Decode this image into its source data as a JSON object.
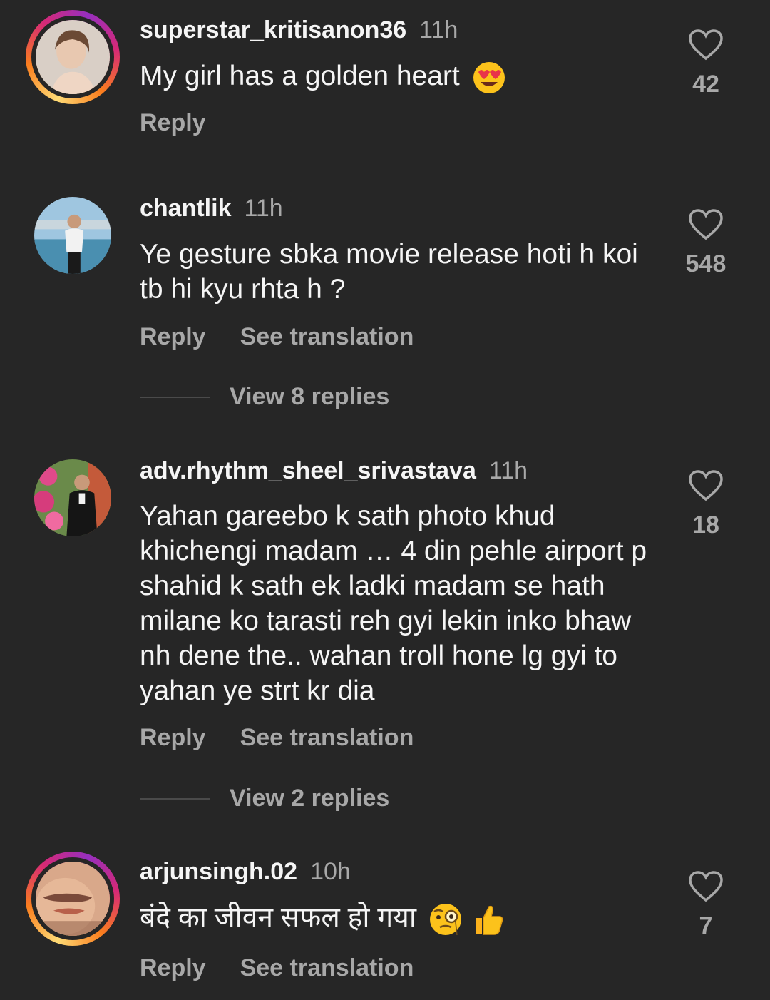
{
  "comments": [
    {
      "username": "superstar_kritisanon36",
      "time": "11h",
      "text": "My girl has a golden heart",
      "emoji": "heart-eyes",
      "likes": "42",
      "reply": "Reply",
      "has_story_ring": true
    },
    {
      "username": "chantlik",
      "time": "11h",
      "text": "Ye gesture sbka movie release hoti h koi tb hi kyu rhta h ?",
      "likes": "548",
      "reply": "Reply",
      "see_translation": "See translation",
      "view_replies": "View 8 replies"
    },
    {
      "username": "adv.rhythm_sheel_srivastava",
      "time": "11h",
      "text": "Yahan gareebo k sath photo khud khichengi madam … 4 din pehle airport p shahid k sath ek ladki madam se hath milane ko tarasti reh gyi lekin inko bhaw nh dene the.. wahan troll hone lg gyi to yahan ye strt kr dia",
      "likes": "18",
      "reply": "Reply",
      "see_translation": "See translation",
      "view_replies": "View 2 replies"
    },
    {
      "username": "arjunsingh.02",
      "time": "10h",
      "text": "बंदे का जीवन सफल हो गया",
      "emoji": "monocle-face, thumbs-up",
      "likes": "7",
      "reply": "Reply",
      "see_translation": "See translation",
      "has_story_ring": true
    }
  ],
  "colors": {
    "background": "#262626",
    "primary_text": "#f5f5f5",
    "secondary_text": "#a8a8a8"
  }
}
